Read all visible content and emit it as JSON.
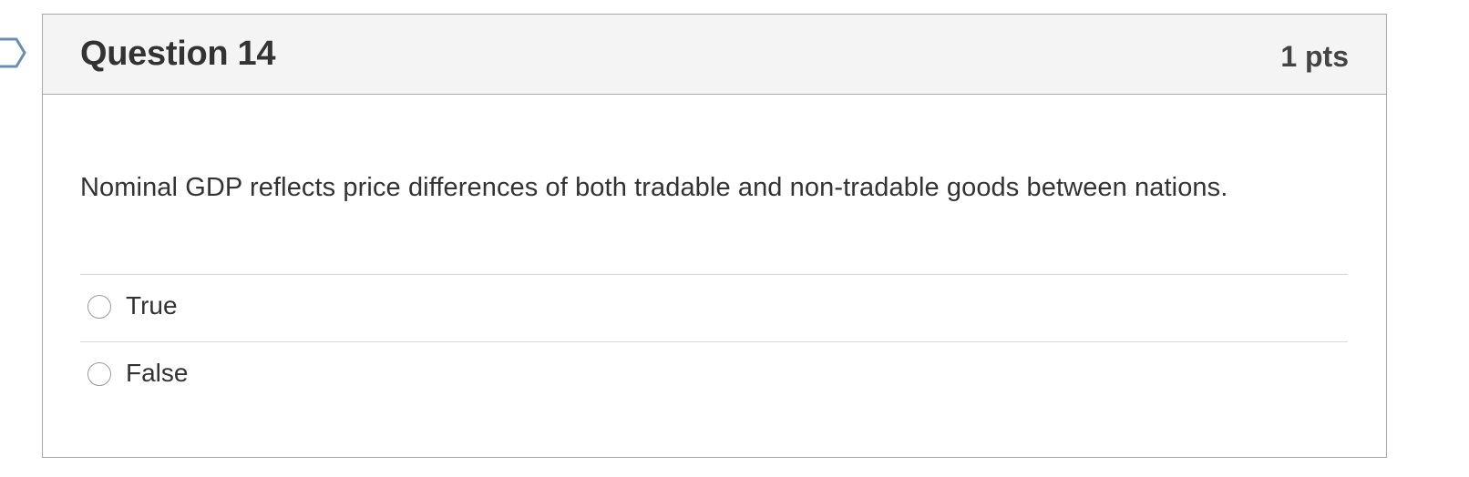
{
  "question": {
    "title": "Question 14",
    "points": "1 pts",
    "text": "Nominal GDP reflects price differences of both tradable and non-tradable goods between nations.",
    "answers": [
      {
        "label": "True",
        "selected": false
      },
      {
        "label": "False",
        "selected": false
      }
    ]
  },
  "icons": {
    "flag": "flag-question-icon"
  },
  "colors": {
    "border": "#aaaaaa",
    "header_bg": "#f4f4f4",
    "text": "#333333",
    "flag_stroke": "#6a8db3"
  }
}
